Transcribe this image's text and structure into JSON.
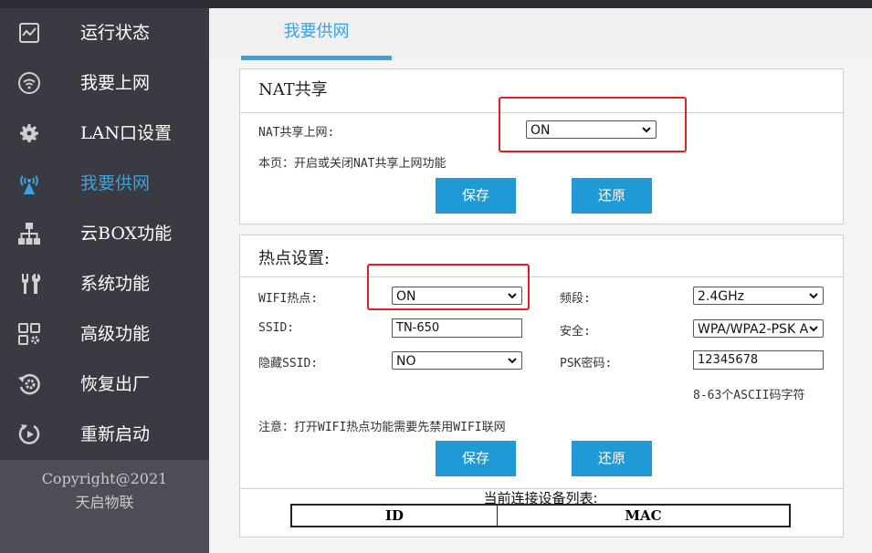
{
  "sidebar": {
    "items": [
      {
        "label": "运行状态",
        "icon": "chart-screen-icon"
      },
      {
        "label": "我要上网",
        "icon": "wifi-icon"
      },
      {
        "label": "LAN口设置",
        "icon": "gear-icon"
      },
      {
        "label": "我要供网",
        "icon": "broadcast-antenna-icon"
      },
      {
        "label": "云BOX功能",
        "icon": "network-tree-icon"
      },
      {
        "label": "系统功能",
        "icon": "tools-icon"
      },
      {
        "label": "高级功能",
        "icon": "grid-settings-icon"
      },
      {
        "label": "恢复出厂",
        "icon": "restore-icon"
      },
      {
        "label": "重新启动",
        "icon": "restart-icon"
      }
    ],
    "active_index": 3,
    "copyright_line1": "Copyright@2021",
    "copyright_line2": "天启物联"
  },
  "tab": {
    "label": "我要供网"
  },
  "nat": {
    "title": "NAT共享",
    "field_label": "NAT共享上网:",
    "value": "ON",
    "description": "本页：开启或关闭NAT共享上网功能",
    "save_label": "保存",
    "reset_label": "还原"
  },
  "hotspot": {
    "title": "热点设置:",
    "wifi_label": "WIFI热点:",
    "wifi_value": "ON",
    "band_label": "频段:",
    "band_value": "2.4GHz",
    "ssid_label": "SSID:",
    "ssid_value": "TN-650",
    "security_label": "安全:",
    "security_value": "WPA/WPA2-PSK A",
    "hide_ssid_label": "隐藏SSID:",
    "hide_ssid_value": "NO",
    "psk_label": "PSK密码:",
    "psk_value": "12345678",
    "psk_hint": "8-63个ASCII码字符",
    "note": "注意：打开WIFI热点功能需要先禁用WIFI联网",
    "save_label": "保存",
    "reset_label": "还原"
  },
  "devices": {
    "title": "当前连接设备列表:",
    "col_id": "ID",
    "col_mac": "MAC"
  },
  "colors": {
    "accent": "#3ba1e0",
    "button": "#1f9ad6",
    "highlight": "#e02020"
  }
}
